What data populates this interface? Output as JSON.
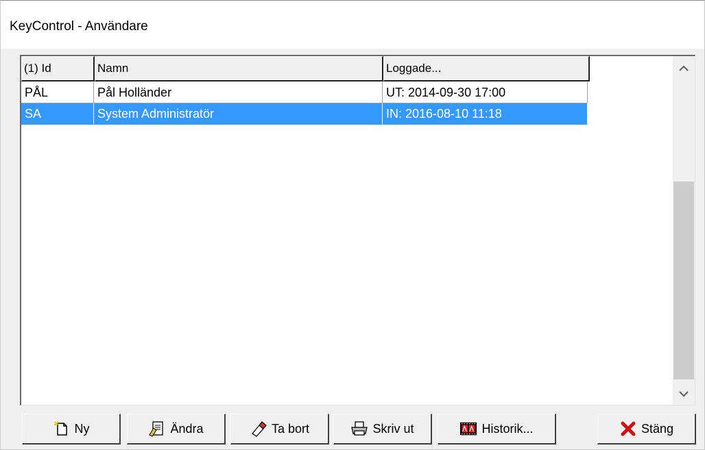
{
  "window": {
    "title": "KeyControl - Användare"
  },
  "list": {
    "columns": [
      "(1) Id",
      "Namn",
      "Loggade..."
    ],
    "rows": [
      {
        "id": "PÅL",
        "name": "Pål Holländer",
        "logged": "UT: 2014-09-30 17:00",
        "selected": false
      },
      {
        "id": "SA",
        "name": "System Administratör",
        "logged": "IN: 2016-08-10 11:18",
        "selected": true
      }
    ]
  },
  "scrollbar": {
    "up_icon": "chevron-up-icon",
    "down_icon": "chevron-down-icon"
  },
  "buttons": {
    "new": {
      "label": "Ny",
      "icon": "new-document-icon"
    },
    "edit": {
      "label": "Ändra",
      "icon": "edit-document-icon"
    },
    "delete": {
      "label": "Ta bort",
      "icon": "eraser-icon"
    },
    "print": {
      "label": "Skriv ut",
      "icon": "printer-icon"
    },
    "history": {
      "label": "Historik...",
      "icon": "film-history-icon"
    },
    "close": {
      "label": "Stäng",
      "icon": "close-x-icon"
    }
  },
  "colors": {
    "selection": "#3399ff",
    "close_x": "#d01010"
  }
}
